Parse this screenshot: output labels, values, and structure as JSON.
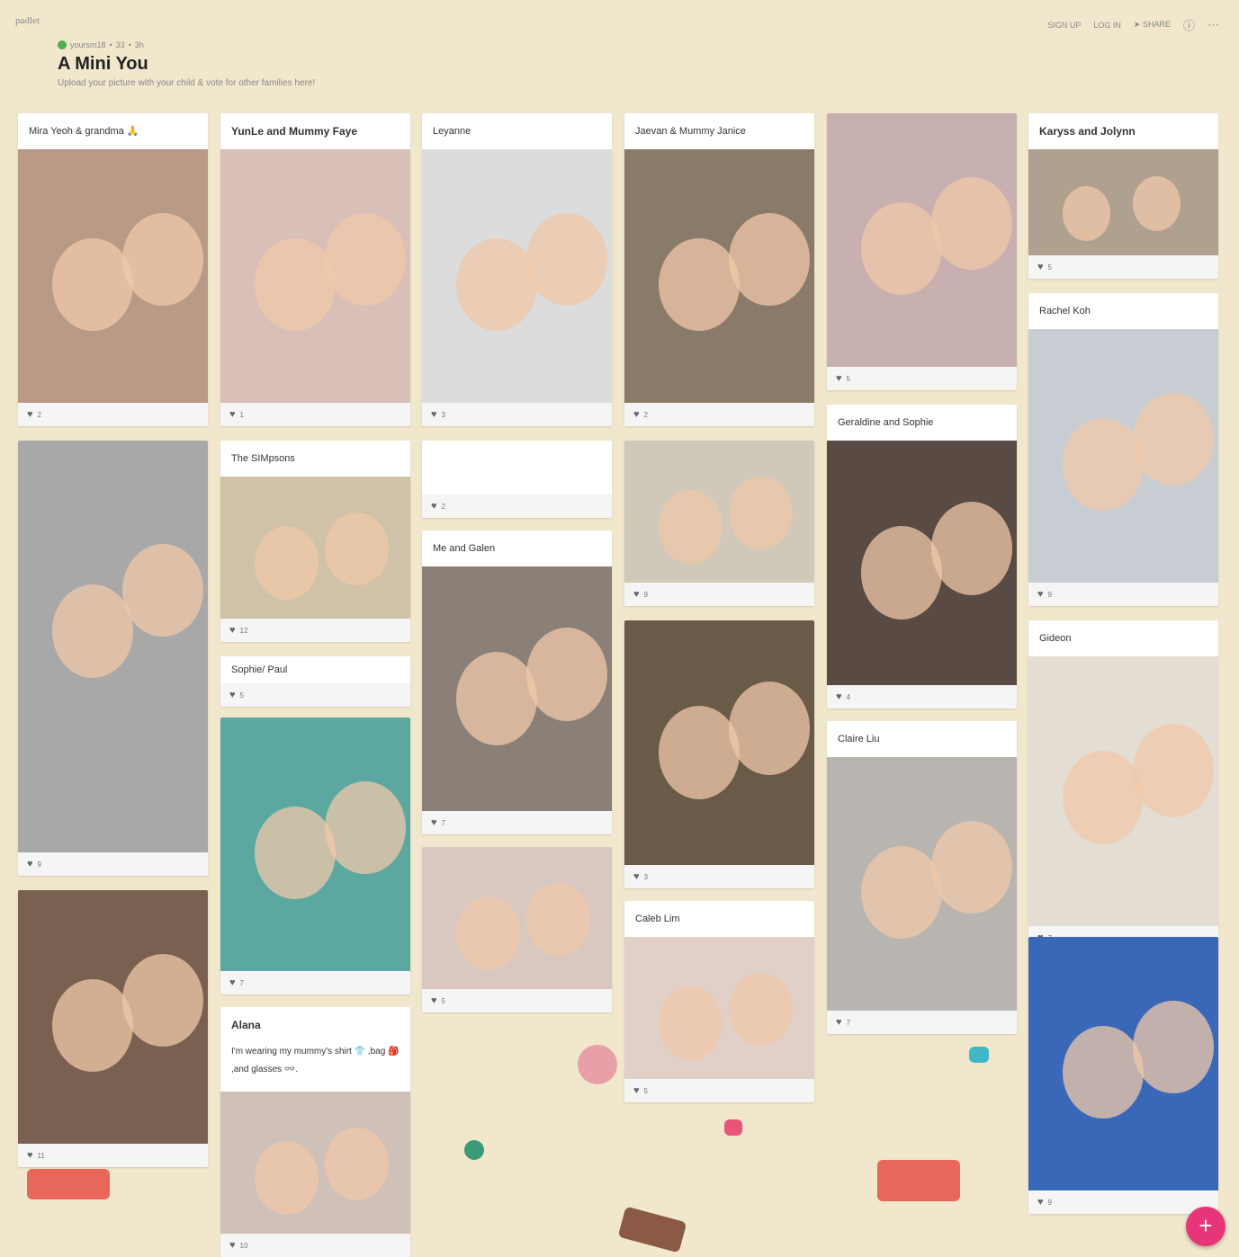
{
  "app": {
    "logo": "padlet"
  },
  "nav": {
    "signup": "SIGN UP",
    "login": "LOG IN",
    "share": "SHARE",
    "help_icon": "help-icon",
    "more_icon": "more-icon"
  },
  "board": {
    "author": "yoursm18",
    "likes": "33",
    "age": "3h",
    "title": "A Mini You",
    "subtitle": "Upload your picture with your child & vote for other families here!"
  },
  "colors": {
    "background": "#f1e7cc",
    "accent": "#e8357a"
  },
  "posts": [
    {
      "title": "Mira Yeoh & grandma 🙏",
      "likes": "2"
    },
    {
      "title": "YunLe and Mummy Faye",
      "likes": "1"
    },
    {
      "title": "Leyanne",
      "likes": "3"
    },
    {
      "title": "Jaevan & Mummy Janice",
      "likes": "2"
    },
    {
      "title": "",
      "likes": "5"
    },
    {
      "title": "Karyss and Jolynn",
      "likes": "5"
    },
    {
      "title": "Rachel Koh",
      "likes": "9"
    },
    {
      "title": "",
      "likes": "9"
    },
    {
      "title": "The SIMpsons",
      "likes": "12"
    },
    {
      "title": "",
      "likes": "2"
    },
    {
      "title": "",
      "likes": "9"
    },
    {
      "title": "Geraldine and Sophie",
      "likes": "4"
    },
    {
      "title": "Sophie/ Paul",
      "likes": "5"
    },
    {
      "title": "Me and Galen",
      "likes": "7"
    },
    {
      "title": "Gideon",
      "likes": "7"
    },
    {
      "title": "",
      "likes": "3"
    },
    {
      "title": "Claire Liu",
      "likes": "7"
    },
    {
      "title": "",
      "likes": "7"
    },
    {
      "title": "",
      "likes": "5"
    },
    {
      "title": "Caleb Lim",
      "likes": "5"
    },
    {
      "title": "",
      "likes": "11"
    },
    {
      "title": "Alana",
      "body": "I'm wearing my mummy's shirt 👕 ,bag 🎒 ,and glasses 👓.",
      "likes": "10"
    },
    {
      "title": "",
      "likes": "9"
    }
  ],
  "fab": {
    "label": "+"
  }
}
